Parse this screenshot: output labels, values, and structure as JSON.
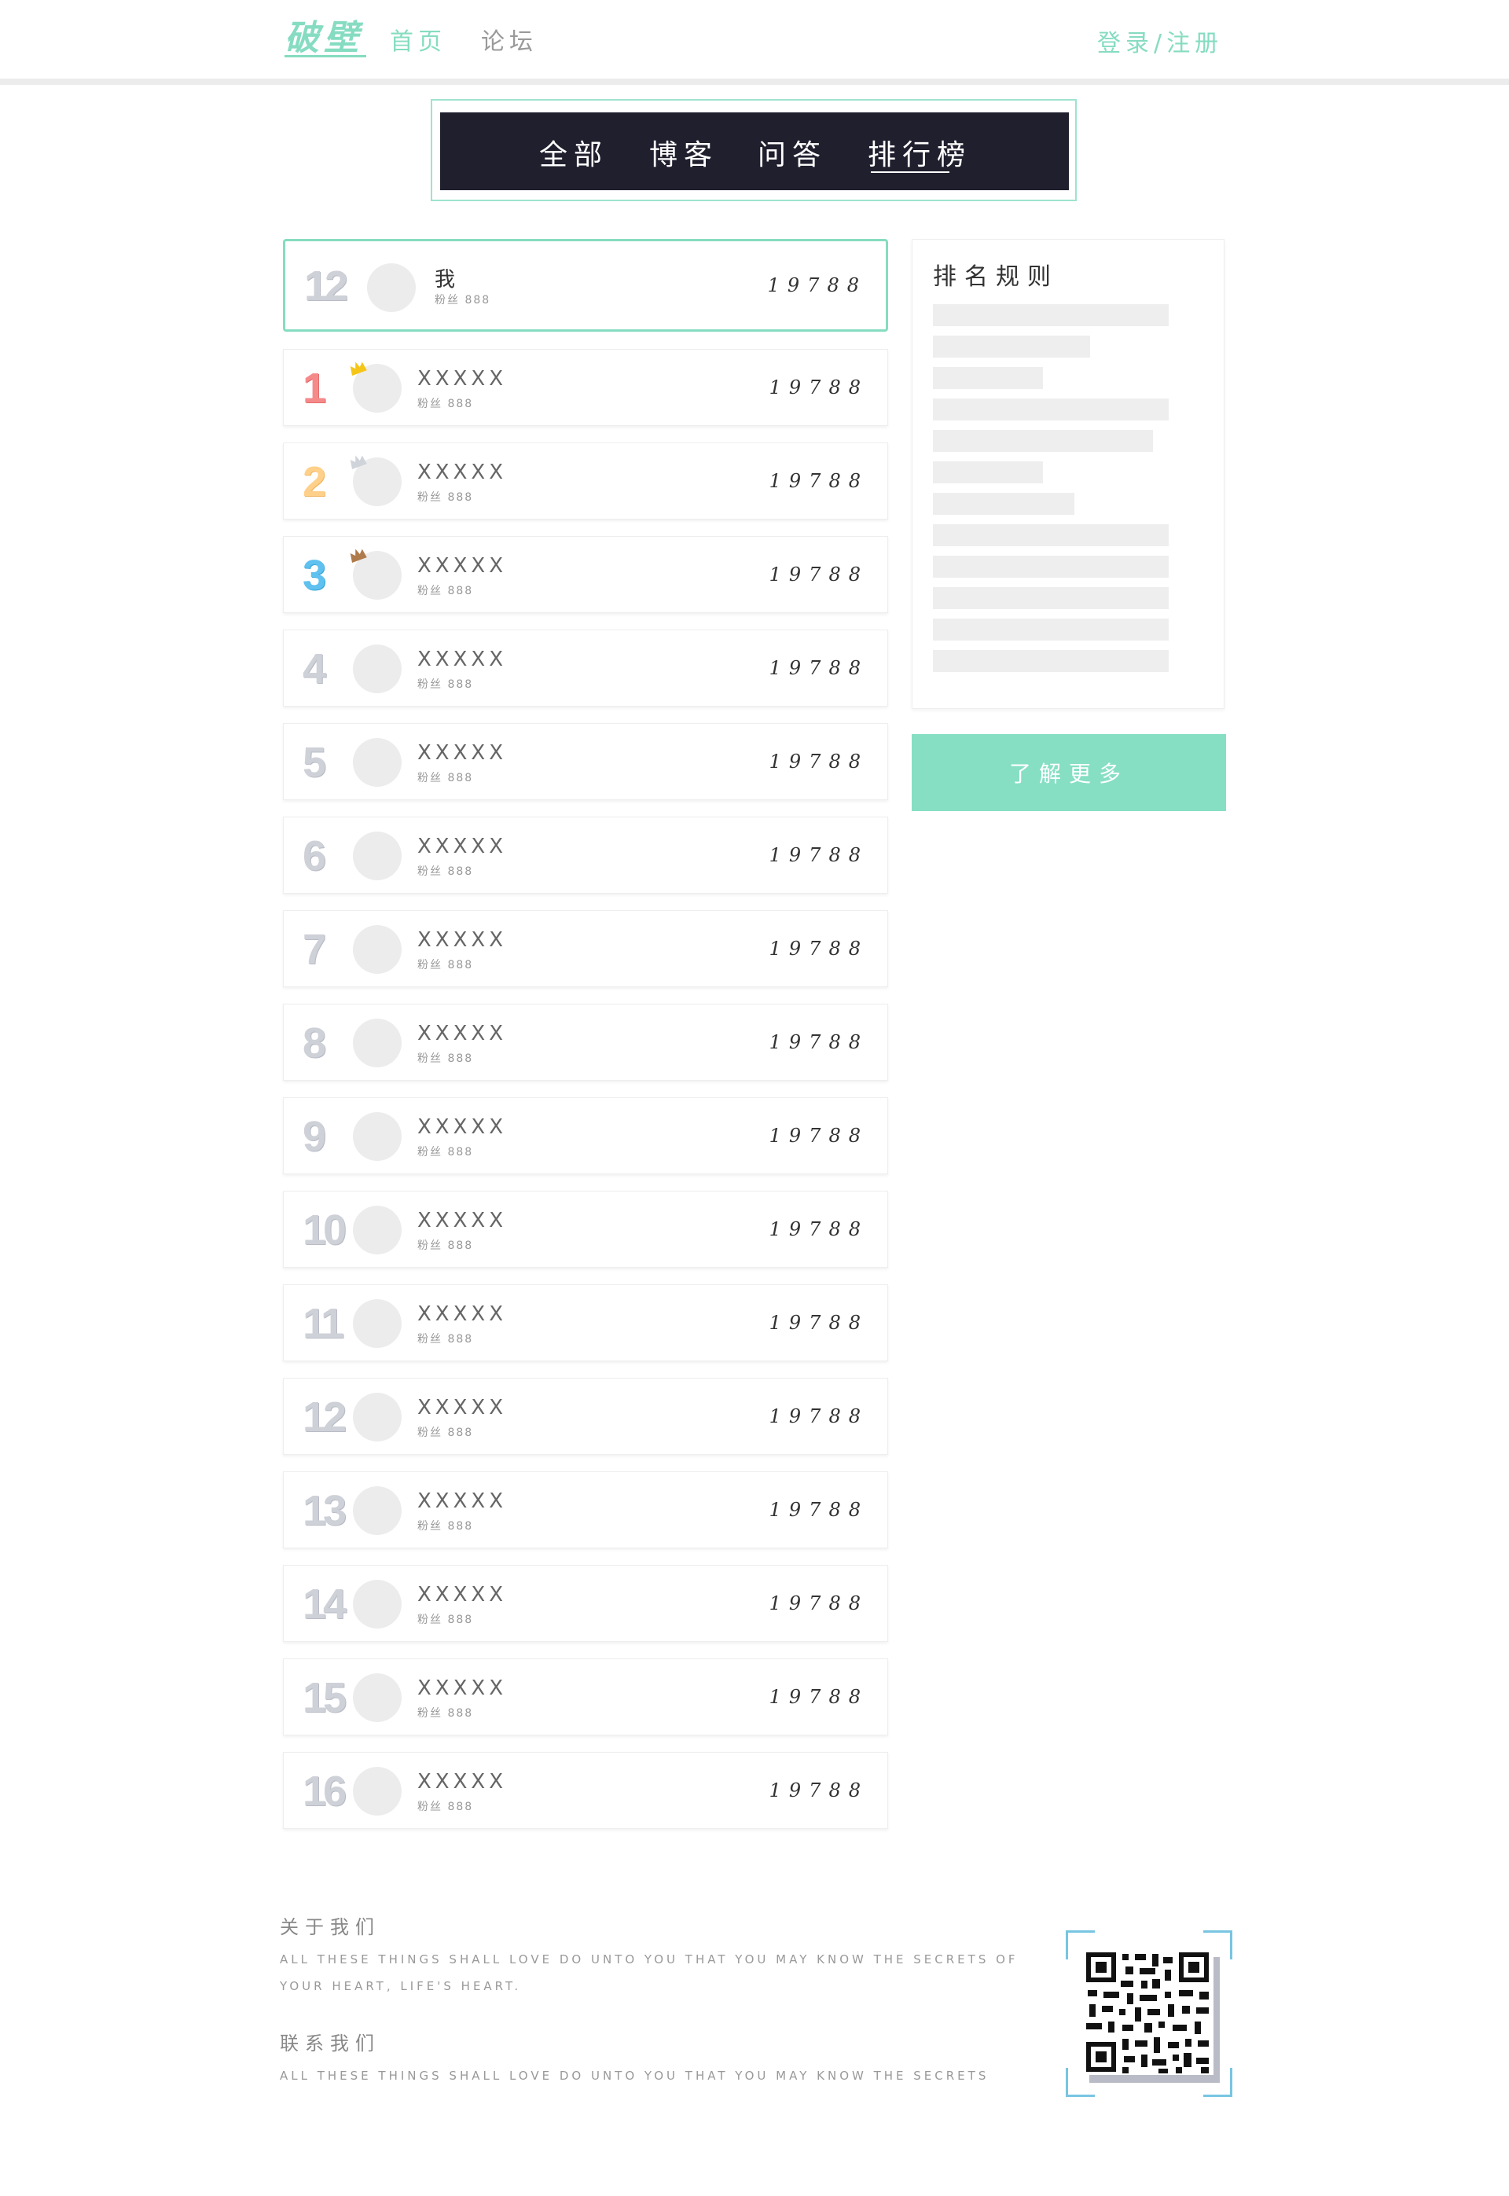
{
  "header": {
    "logo": "破壁",
    "nav": [
      "首页",
      "论坛"
    ],
    "login": "登录/注册"
  },
  "tabs": [
    "全部",
    "博客",
    "问答",
    "排行榜"
  ],
  "active_tab": "排行榜",
  "me": {
    "rank": "12",
    "name": "我",
    "fans": "粉丝 888",
    "score": "19788"
  },
  "list": [
    {
      "rank": "1",
      "name": "XXXXX",
      "fans": "粉丝 888",
      "score": "19788",
      "medal": "gold-crown-icon"
    },
    {
      "rank": "2",
      "name": "XXXXX",
      "fans": "粉丝 888",
      "score": "19788",
      "medal": "silver-crown-icon"
    },
    {
      "rank": "3",
      "name": "XXXXX",
      "fans": "粉丝 888",
      "score": "19788",
      "medal": "bronze-crown-icon"
    },
    {
      "rank": "4",
      "name": "XXXXX",
      "fans": "粉丝 888",
      "score": "19788"
    },
    {
      "rank": "5",
      "name": "XXXXX",
      "fans": "粉丝 888",
      "score": "19788"
    },
    {
      "rank": "6",
      "name": "XXXXX",
      "fans": "粉丝 888",
      "score": "19788"
    },
    {
      "rank": "7",
      "name": "XXXXX",
      "fans": "粉丝 888",
      "score": "19788"
    },
    {
      "rank": "8",
      "name": "XXXXX",
      "fans": "粉丝 888",
      "score": "19788"
    },
    {
      "rank": "9",
      "name": "XXXXX",
      "fans": "粉丝 888",
      "score": "19788"
    },
    {
      "rank": "10",
      "name": "XXXXX",
      "fans": "粉丝 888",
      "score": "19788"
    },
    {
      "rank": "11",
      "name": "XXXXX",
      "fans": "粉丝 888",
      "score": "19788"
    },
    {
      "rank": "12",
      "name": "XXXXX",
      "fans": "粉丝 888",
      "score": "19788"
    },
    {
      "rank": "13",
      "name": "XXXXX",
      "fans": "粉丝 888",
      "score": "19788"
    },
    {
      "rank": "14",
      "name": "XXXXX",
      "fans": "粉丝 888",
      "score": "19788"
    },
    {
      "rank": "15",
      "name": "XXXXX",
      "fans": "粉丝 888",
      "score": "19788"
    },
    {
      "rank": "16",
      "name": "XXXXX",
      "fans": "粉丝 888",
      "score": "19788"
    }
  ],
  "rules": {
    "title": "排名规则",
    "more_button": "了解更多"
  },
  "footer": {
    "about_title": "关于我们",
    "about_text": "ALL THESE THINGS SHALL LOVE DO UNTO YOU THAT YOU MAY KNOW THE SECRETS OF YOUR HEART, LIFE'S HEART.",
    "contact_title": "联系我们",
    "contact_text": "ALL THESE THINGS SHALL LOVE DO UNTO YOU THAT YOU MAY KNOW THE SECRETS"
  },
  "colors": {
    "accent": "#86dcc1",
    "banner": "#1f1f2e",
    "rank1": "#f58a8a",
    "rank2": "#ffd08a",
    "rank3": "#5fc1ef"
  }
}
